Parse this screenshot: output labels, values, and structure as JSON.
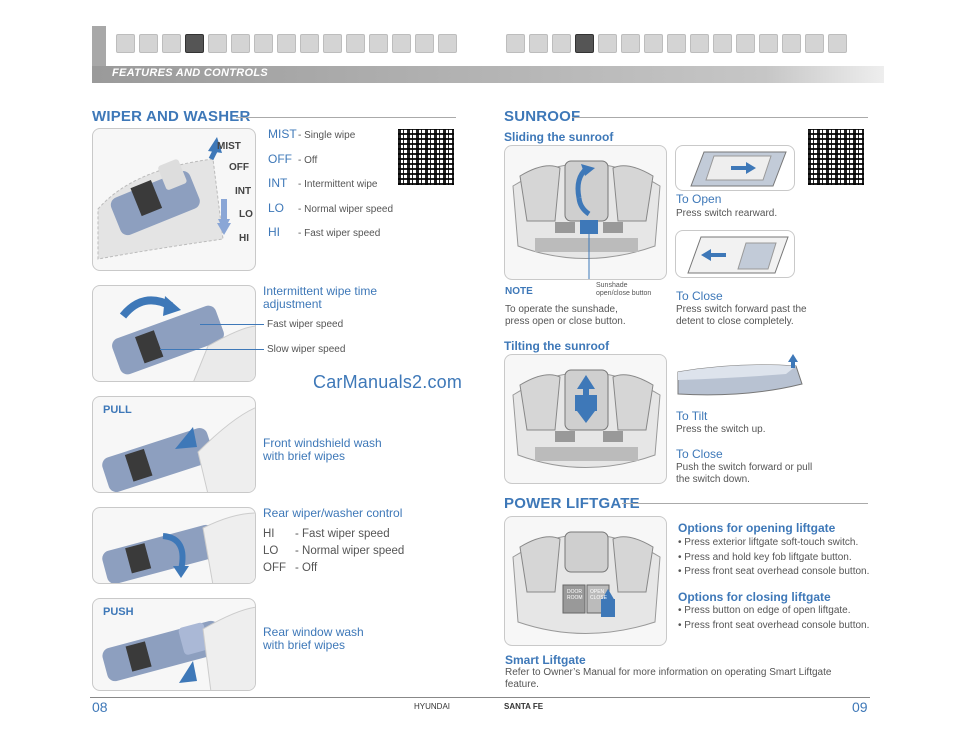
{
  "header": {
    "section": "FEATURES AND CONTROLS"
  },
  "left": {
    "wiper": {
      "title": "WIPER AND WASHER",
      "switch_labels": [
        "MIST",
        "OFF",
        "INT",
        "LO",
        "HI"
      ],
      "modes": [
        {
          "key": "MIST",
          "desc": "- Single wipe"
        },
        {
          "key": "OFF",
          "desc": "- Off"
        },
        {
          "key": "INT",
          "desc": "- Intermittent wipe"
        },
        {
          "key": "LO",
          "desc": "- Normal wiper speed"
        },
        {
          "key": "HI",
          "desc": "- Fast wiper speed"
        }
      ],
      "intermittent": {
        "title_line1": "Intermittent wipe time",
        "title_line2": "adjustment",
        "fast": "Fast wiper speed",
        "slow": "Slow wiper speed"
      },
      "watermark": "CarManuals2.com",
      "pull_label": "PULL",
      "front_wash": {
        "line1": "Front windshield wash",
        "line2": "with brief wipes"
      },
      "rear_control": {
        "title": "Rear wiper/washer control",
        "items": [
          {
            "key": "HI",
            "desc": "- Fast wiper speed"
          },
          {
            "key": "LO",
            "desc": "- Normal wiper speed"
          },
          {
            "key": "OFF",
            "desc": "- Off"
          }
        ]
      },
      "push_label": "PUSH",
      "rear_wash": {
        "line1": "Rear window wash",
        "line2": "with brief wipes"
      }
    },
    "page_number": "08",
    "brand": "HYUNDAI"
  },
  "right": {
    "sunroof": {
      "title": "SUNROOF",
      "sliding_title": "Sliding the sunroof",
      "sunshade_label_line1": "Sunshade",
      "sunshade_label_line2": "open/close button",
      "to_open_title": "To Open",
      "to_open_desc": "Press switch rearward.",
      "to_close_title": "To Close",
      "to_close_desc_line1": "Press switch forward past the",
      "to_close_desc_line2": "detent to close completely.",
      "note_title": "NOTE",
      "note_line1": "To operate the sunshade,",
      "note_line2": "press open or close button.",
      "tilting_title": "Tilting the sunroof",
      "to_tilt_title": "To Tilt",
      "to_tilt_desc": "Press the switch up.",
      "tilt_close_title": "To Close",
      "tilt_close_line1": "Push the switch forward or pull",
      "tilt_close_line2": "the switch down."
    },
    "liftgate": {
      "title": "POWER LIFTGATE",
      "console_labels": [
        "DOOR",
        "ROOM",
        "OPEN",
        "CLOSE"
      ],
      "opening_title": "Options for opening liftgate",
      "opening_items": [
        "• Press exterior liftgate soft-touch switch.",
        "• Press and hold key fob liftgate button.",
        "• Press front seat overhead console button."
      ],
      "closing_title": "Options for closing liftgate",
      "closing_items": [
        "• Press button on edge of open liftgate.",
        "• Press front seat overhead console button."
      ],
      "smart_title": "Smart Liftgate",
      "smart_line1": "Refer to Owner’s Manual for more information on operating Smart Liftgate",
      "smart_line2": "feature."
    },
    "page_number": "09",
    "model": "SANTA FE"
  },
  "colors": {
    "accent": "#3e78b8",
    "header_gray": "#a8a8a8"
  }
}
